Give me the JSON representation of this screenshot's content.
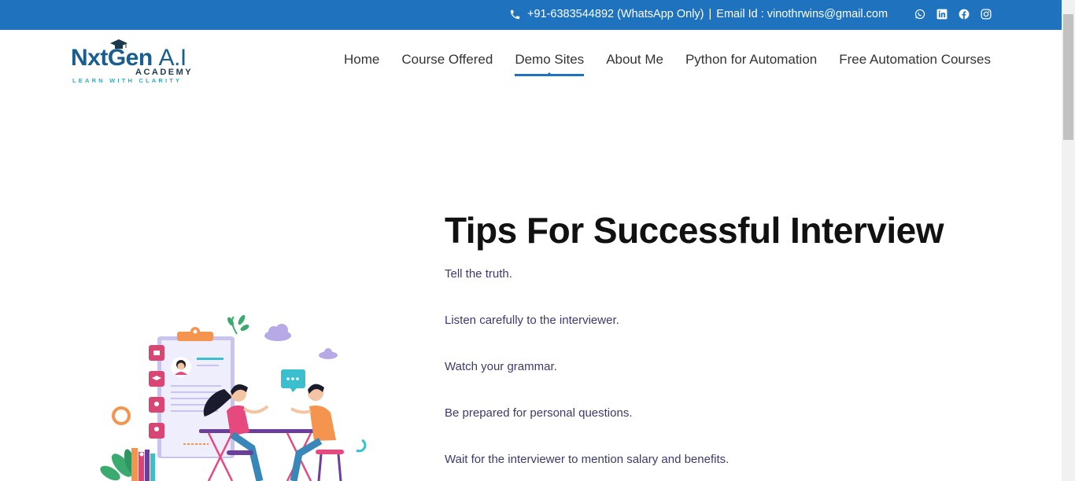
{
  "topbar": {
    "phone": "+91-6383544892 (WhatsApp Only)",
    "separator": "|",
    "email": "Email Id : vinothrwins@gmail.com",
    "socials": [
      "whatsapp-icon",
      "linkedin-icon",
      "facebook-icon",
      "instagram-icon"
    ]
  },
  "logo": {
    "brand": "NxtGen",
    "brand_ai": "A.I",
    "academy": "ACADEMY",
    "tagline": "LEARN WITH CLARITY"
  },
  "nav": {
    "items": [
      {
        "label": "Home"
      },
      {
        "label": "Course Offered"
      },
      {
        "label": "Demo Sites",
        "active": true
      },
      {
        "label": "About Me"
      },
      {
        "label": "Python for Automation"
      },
      {
        "label": "Free Automation Courses"
      }
    ]
  },
  "main": {
    "title": "Tips For Successful Interview",
    "tips": [
      "Tell the truth.",
      "Listen carefully to the interviewer.",
      "Watch your grammar.",
      "Be prepared for personal questions.",
      "Wait for the interviewer to mention salary and benefits."
    ]
  },
  "colors": {
    "topbar": "#1e72be",
    "brand": "#1a5e8f",
    "tagline": "#2aaec8",
    "tip_text": "#3b3b6b"
  }
}
